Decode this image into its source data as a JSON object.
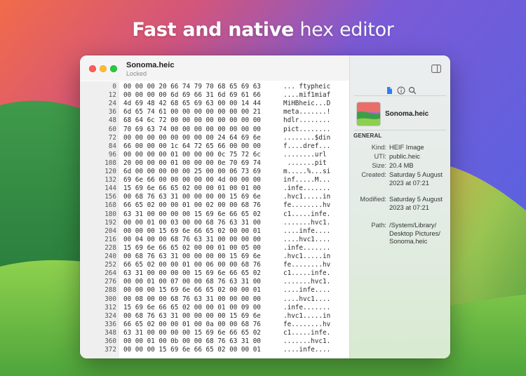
{
  "headline": {
    "bold": "Fast and native",
    "light": "hex editor"
  },
  "window": {
    "title": "Sonoma.heic",
    "subtitle": "Locked"
  },
  "hex_rows": [
    {
      "offset": "0",
      "hex": "00 00 00 20 66 74 79 70 68 65 69 63",
      "ascii": "... ftypheic"
    },
    {
      "offset": "12",
      "hex": "00 00 00 00 6d 69 66 31 6d 69 61 66",
      "ascii": "....mif1miaf"
    },
    {
      "offset": "24",
      "hex": "4d 69 48 42 68 65 69 63 00 00 14 44",
      "ascii": "MiHBheic...D"
    },
    {
      "offset": "36",
      "hex": "6d 65 74 61 00 00 00 00 00 00 00 21",
      "ascii": "meta.......!"
    },
    {
      "offset": "48",
      "hex": "68 64 6c 72 00 00 00 00 00 00 00 00",
      "ascii": "hdlr........"
    },
    {
      "offset": "60",
      "hex": "70 69 63 74 00 00 00 00 00 00 00 00",
      "ascii": "pict........"
    },
    {
      "offset": "72",
      "hex": "00 00 00 00 00 00 00 00 24 64 69 6e",
      "ascii": "........$din"
    },
    {
      "offset": "84",
      "hex": "66 00 00 00 1c 64 72 65 66 00 00 00",
      "ascii": "f....dref..."
    },
    {
      "offset": "96",
      "hex": "00 00 00 00 01 00 00 00 0c 75 72 6c",
      "ascii": "........url"
    },
    {
      "offset": "108",
      "hex": "20 00 00 00 01 00 00 00 0e 70 69 74",
      "ascii": " .......pit"
    },
    {
      "offset": "120",
      "hex": "6d 00 00 00 00 00 25 00 00 06 73 69",
      "ascii": "m.....%...si"
    },
    {
      "offset": "132",
      "hex": "69 6e 66 00 00 00 00 00 4d 00 00 00",
      "ascii": "inf.....M..."
    },
    {
      "offset": "144",
      "hex": "15 69 6e 66 65 02 00 00 01 00 01 00",
      "ascii": ".infe......."
    },
    {
      "offset": "156",
      "hex": "00 68 76 63 31 00 00 00 00 15 69 6e",
      "ascii": ".hvc1.....in"
    },
    {
      "offset": "168",
      "hex": "66 65 02 00 00 01 00 02 00 00 68 76",
      "ascii": "fe........hv"
    },
    {
      "offset": "180",
      "hex": "63 31 00 00 00 00 15 69 6e 66 65 02",
      "ascii": "c1.....infe."
    },
    {
      "offset": "192",
      "hex": "00 00 01 00 03 00 00 68 76 63 31 00",
      "ascii": ".......hvc1."
    },
    {
      "offset": "204",
      "hex": "00 00 00 15 69 6e 66 65 02 00 00 01",
      "ascii": "....infe...."
    },
    {
      "offset": "216",
      "hex": "00 04 00 00 68 76 63 31 00 00 00 00",
      "ascii": "....hvc1...."
    },
    {
      "offset": "228",
      "hex": "15 69 6e 66 65 02 00 00 01 00 05 00",
      "ascii": ".infe......."
    },
    {
      "offset": "240",
      "hex": "00 68 76 63 31 00 00 00 00 15 69 6e",
      "ascii": ".hvc1.....in"
    },
    {
      "offset": "252",
      "hex": "66 65 02 00 00 01 00 06 00 00 68 76",
      "ascii": "fe........hv"
    },
    {
      "offset": "264",
      "hex": "63 31 00 00 00 00 15 69 6e 66 65 02",
      "ascii": "c1.....infe."
    },
    {
      "offset": "276",
      "hex": "00 00 01 00 07 00 00 68 76 63 31 00",
      "ascii": ".......hvc1."
    },
    {
      "offset": "288",
      "hex": "00 00 00 15 69 6e 66 65 02 00 00 01",
      "ascii": "....infe...."
    },
    {
      "offset": "300",
      "hex": "00 08 00 00 68 76 63 31 00 00 00 00",
      "ascii": "....hvc1...."
    },
    {
      "offset": "312",
      "hex": "15 69 6e 66 65 02 00 00 01 00 09 00",
      "ascii": ".infe......."
    },
    {
      "offset": "324",
      "hex": "00 68 76 63 31 00 00 00 00 15 69 6e",
      "ascii": ".hvc1.....in"
    },
    {
      "offset": "336",
      "hex": "66 65 02 00 00 01 00 0a 00 00 68 76",
      "ascii": "fe........hv"
    },
    {
      "offset": "348",
      "hex": "63 31 00 00 00 00 15 69 6e 66 65 02",
      "ascii": "c1.....infe."
    },
    {
      "offset": "360",
      "hex": "00 00 01 00 0b 00 00 68 76 63 31 00",
      "ascii": ".......hvc1."
    },
    {
      "offset": "372",
      "hex": "00 00 00 15 69 6e 66 65 02 00 00 01",
      "ascii": "....infe...."
    }
  ],
  "inspector": {
    "icons": [
      "document-icon",
      "info-icon",
      "search-icon"
    ],
    "file_name": "Sonoma.heic",
    "section_title": "GENERAL",
    "fields": [
      {
        "key": "Kind:",
        "value": "HEIF Image"
      },
      {
        "key": "UTI:",
        "value": "public.heic"
      },
      {
        "key": "Size:",
        "value": "20.4 MB"
      },
      {
        "key": "Created:",
        "value": "Saturday 5 August 2023 at 07:21"
      },
      {
        "key": "Modified:",
        "value": "Saturday 5 August 2023 at 07:21"
      },
      {
        "key": "Path:",
        "value": "/System/Library/ Desktop Pictures/ Sonoma.heic"
      }
    ]
  },
  "colors": {
    "accent": "#2f7df6",
    "close": "#ff5f57",
    "minimize": "#febc2e",
    "maximize": "#28c840"
  }
}
